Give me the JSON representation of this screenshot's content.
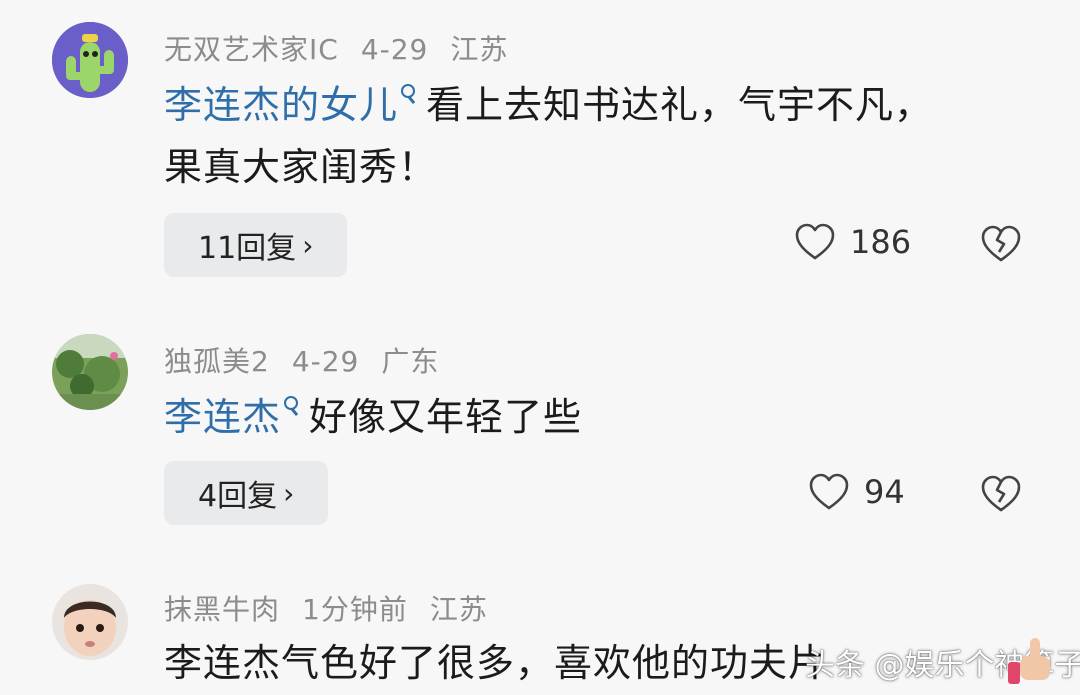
{
  "comments": [
    {
      "username": "无双艺术家IC",
      "date": "4-29",
      "location": "江苏",
      "mention": "李连杰的女儿",
      "text_line1": "看上去知书达礼，气宇不凡，",
      "text_line2": "果真大家闺秀！",
      "replies": "11回复",
      "likes": "186"
    },
    {
      "username": "独孤美2",
      "date": "4-29",
      "location": "广东",
      "mention": "李连杰",
      "text_line1": "好像又年轻了些",
      "replies": "4回复",
      "likes": "94"
    },
    {
      "username": "抹黑牛肉",
      "date": "1分钟前",
      "location": "江苏",
      "text_line1": "李连杰气色好了很多，喜欢他的功夫片"
    }
  ],
  "reply_chevron": "›",
  "watermark": "头条 @娱乐个神算子",
  "colors": {
    "mention": "#2f6ea8",
    "meta": "#8c8c8c",
    "reply_bg": "#e9eaec",
    "background": "#f7f7f7"
  },
  "icons": [
    "cactus-avatar",
    "garden-photo-avatar",
    "child-photo-avatar",
    "heart-outline-icon",
    "broken-heart-icon",
    "search-icon",
    "thumbs-up-emoji"
  ]
}
